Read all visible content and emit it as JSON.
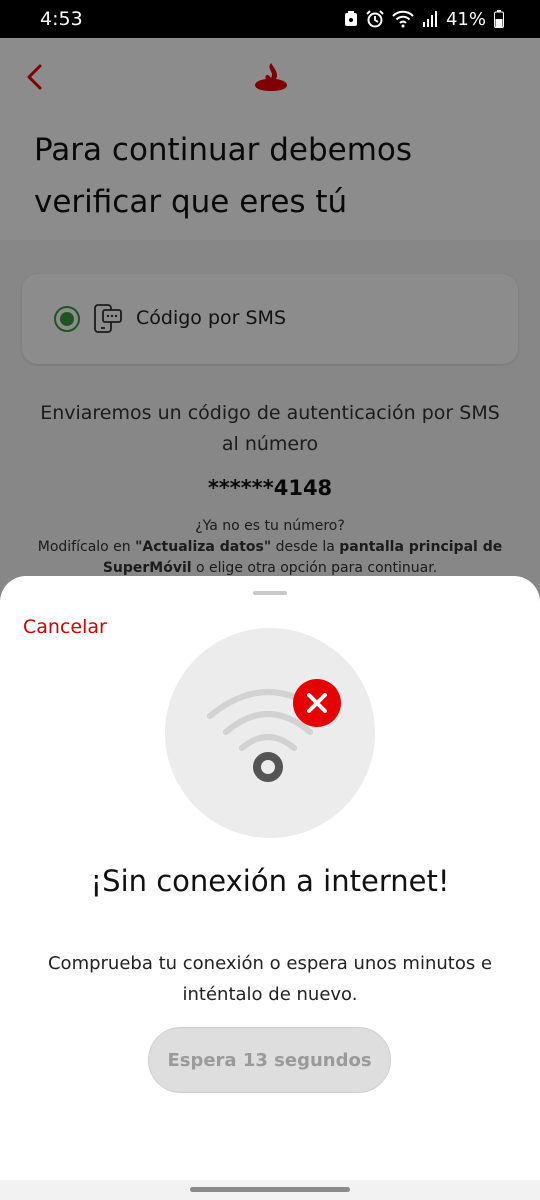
{
  "status_bar": {
    "time": "4:53",
    "battery": "41%"
  },
  "page": {
    "title_line1": "Para continuar debemos",
    "title_line2": "verificar que eres tú",
    "sms_option_label": "Código por SMS",
    "send_text": "Enviaremos un código de autenticación por SMS al número",
    "phone_number": "******4148",
    "not_number_question": "¿Ya no es tu número?",
    "modify_prefix": "Modifícalo en ",
    "modify_bold1": "\"Actualiza datos\"",
    "modify_mid": " desde la ",
    "modify_bold2": "pantalla principal de SuperMóvil",
    "modify_suffix": " o elige otra opción para continuar."
  },
  "sheet": {
    "cancel_label": "Cancelar",
    "title": "¡Sin conexión a internet!",
    "message": "Comprueba tu conexión o espera unos minutos e inténtalo de nuevo.",
    "wait_button_label": "Espera 13 segundos"
  },
  "colors": {
    "brand_red": "#e60000",
    "link_red": "#d00000",
    "radio_green": "#3a9d3a"
  }
}
